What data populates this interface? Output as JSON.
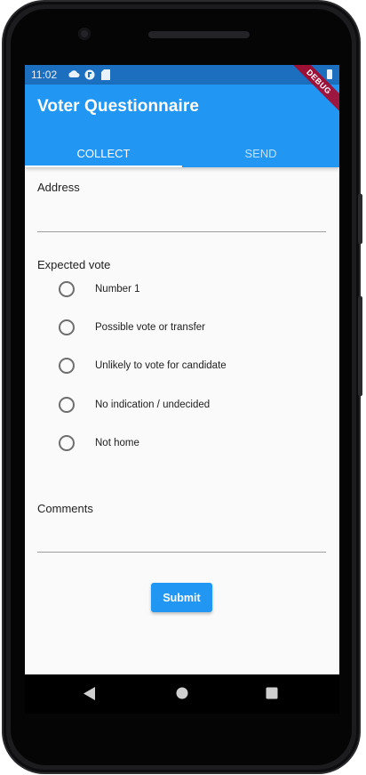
{
  "statusbar": {
    "time": "11:02"
  },
  "appbar": {
    "title": "Voter Questionnaire",
    "debug_label": "DEBUG"
  },
  "tabs": [
    {
      "label": "COLLECT",
      "active": true
    },
    {
      "label": "SEND",
      "active": false
    }
  ],
  "form": {
    "address_label": "Address",
    "address_value": "",
    "expected_vote_label": "Expected vote",
    "options": [
      {
        "label": "Number 1",
        "selected": false
      },
      {
        "label": "Possible vote or transfer",
        "selected": false
      },
      {
        "label": "Unlikely to vote for candidate",
        "selected": false
      },
      {
        "label": "No indication / undecided",
        "selected": false
      },
      {
        "label": "Not home",
        "selected": false
      }
    ],
    "comments_label": "Comments",
    "comments_value": "",
    "submit_label": "Submit"
  },
  "navbar": {
    "icons": [
      "back-icon",
      "home-icon",
      "recents-icon"
    ]
  },
  "colors": {
    "primary": "#2196f3",
    "statusbar": "#1b6fbe"
  }
}
